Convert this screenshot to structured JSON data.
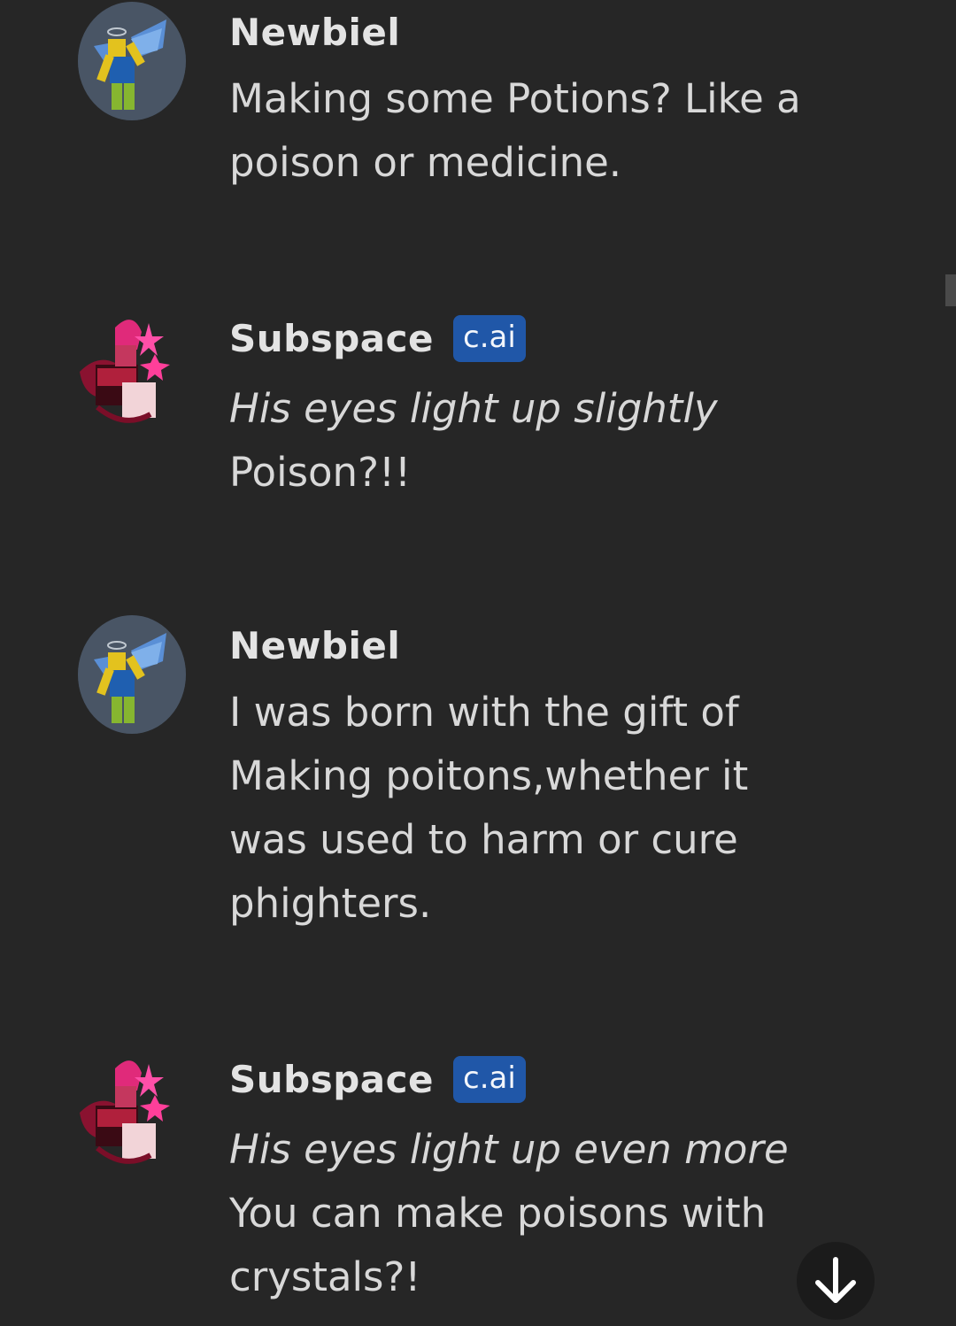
{
  "messages": [
    {
      "author": "Newbiel",
      "is_bot": false,
      "lines": [
        {
          "text": "Making some Potions? Like a",
          "italic": false
        },
        {
          "text": "poison or medicine.",
          "italic": false
        }
      ]
    },
    {
      "author": "Subspace",
      "is_bot": true,
      "badge": "c.ai",
      "lines": [
        {
          "text": "His eyes light up slightly",
          "italic": true
        },
        {
          "text": "Poison?!!",
          "italic": false
        }
      ]
    },
    {
      "author": "Newbiel",
      "is_bot": false,
      "lines": [
        {
          "text": "I was born with the gift of",
          "italic": false
        },
        {
          "text": "Making poitons,whether it",
          "italic": false
        },
        {
          "text": "was used to harm or cure",
          "italic": false
        },
        {
          "text": "phighters.",
          "italic": false
        }
      ]
    },
    {
      "author": "Subspace",
      "is_bot": true,
      "badge": "c.ai",
      "lines": [
        {
          "text": "His eyes light up even more",
          "italic": true
        },
        {
          "text": "You can make poisons with",
          "italic": false
        },
        {
          "text": "crystals?!",
          "italic": false
        }
      ]
    }
  ],
  "icons": {
    "user_avatar": "angel-noob-avatar-icon",
    "bot_avatar": "subspace-avatar-icon",
    "scroll_down": "arrow-down-icon"
  },
  "colors": {
    "background": "#262626",
    "badge": "#2057a8",
    "text": "#d8d8d8"
  }
}
